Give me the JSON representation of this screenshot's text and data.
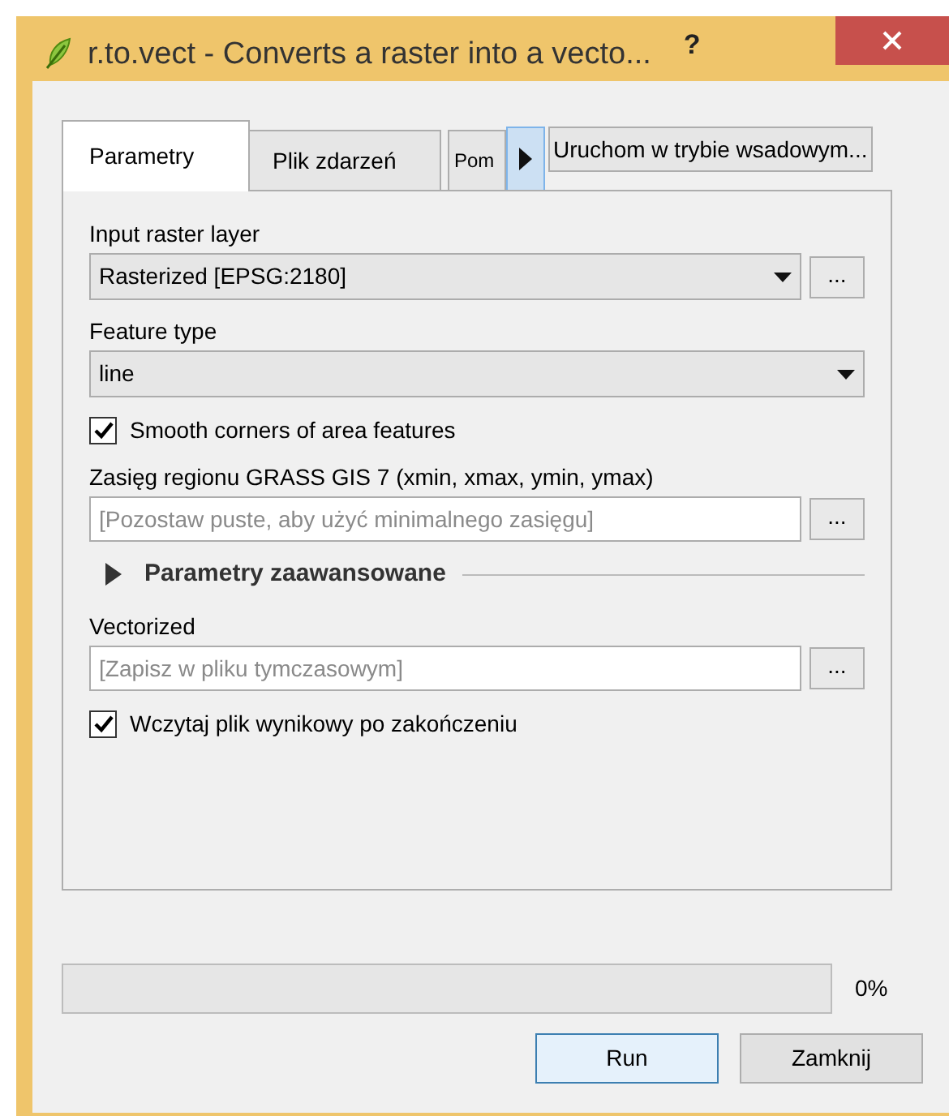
{
  "window": {
    "title": "r.to.vect - Converts a raster into a vecto...",
    "help": "?"
  },
  "tabs": [
    {
      "label": "Parametry",
      "selected": true
    },
    {
      "label": "Plik zdarzeń",
      "selected": false
    },
    {
      "label": "Pom",
      "selected": false
    }
  ],
  "batch_button": "Uruchom w trybie wsadowym...",
  "params": [
    {
      "kind": "combo",
      "label": "Input raster layer",
      "value": "Rasterized [EPSG:2180]",
      "browse": "..."
    },
    {
      "kind": "combo",
      "label": "Feature type",
      "value": "line"
    },
    {
      "kind": "checkbox",
      "label": "Smooth corners of area features",
      "checked": true
    },
    {
      "kind": "text",
      "label": "Zasięg regionu GRASS GIS 7 (xmin, xmax, ymin, ymax)",
      "placeholder": "[Pozostaw puste, aby użyć minimalnego zasięgu]",
      "browse": "..."
    },
    {
      "kind": "section",
      "label": "Parametry zaawansowane",
      "expanded": false
    },
    {
      "kind": "text",
      "label": "Vectorized",
      "placeholder": "[Zapisz w pliku tymczasowym]",
      "browse": "..."
    },
    {
      "kind": "checkbox",
      "label": "Wczytaj plik wynikowy po zakończeniu",
      "checked": true
    }
  ],
  "progress": {
    "level": 0,
    "reading": "0%"
  },
  "buttons": [
    {
      "label": "Run",
      "default": true
    },
    {
      "label": "Zamknij",
      "default": false
    }
  ]
}
